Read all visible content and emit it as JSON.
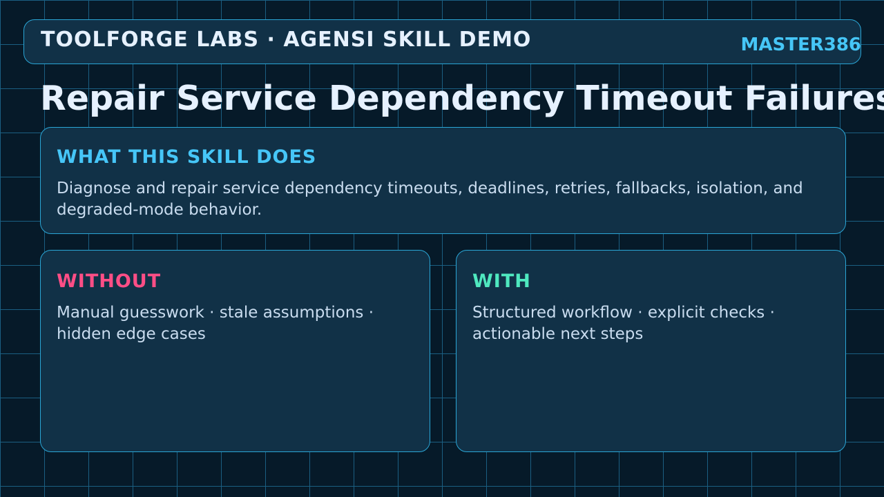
{
  "header": {
    "brand": "TOOLFORGE LABS · AGENSI SKILL DEMO",
    "user": "MASTER386"
  },
  "title": "Repair Service Dependency Timeout Failures",
  "what": {
    "heading": "WHAT THIS SKILL DOES",
    "text": "Diagnose and repair service dependency timeouts, deadlines, retries, fallbacks, isolation, and degraded-mode behavior."
  },
  "without": {
    "heading": "WITHOUT",
    "text": "Manual guesswork · stale assumptions · hidden edge cases"
  },
  "with": {
    "heading": "WITH",
    "text": "Structured workflow · explicit checks · actionable next steps"
  },
  "colors": {
    "background": "#061a29",
    "grid": "#1b5f82",
    "panel": "#113147",
    "border": "#2aa6d6",
    "accent_blue": "#46c6f7",
    "accent_pink": "#ff4e86",
    "accent_green": "#4fe8bf",
    "text_light": "#e6f1ff",
    "text_body": "#c9dcef"
  }
}
